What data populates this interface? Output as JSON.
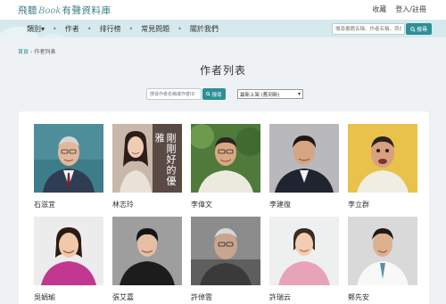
{
  "header": {
    "logo_cn1": "飛聽",
    "logo_en": "Book",
    "logo_cn2": "有聲資料庫",
    "links": [
      "收藏",
      "登入/註冊"
    ]
  },
  "nav": {
    "items": [
      "類別",
      "作者",
      "排行榜",
      "常見問題",
      "關於我們"
    ],
    "category_arrow": "▾",
    "search_placeholder": "搜尋書籍名稱、作者名稱、旁白",
    "search_button": "搜尋"
  },
  "breadcrumb": {
    "home": "首頁",
    "separator": "›",
    "current": "作者列表"
  },
  "page": {
    "title": "作者列表",
    "author_search_placeholder": "搜尋作者名稱或作者ID",
    "author_search_button": "搜尋",
    "sort_selected": "最新上架 (舊到新)"
  },
  "authors": [
    {
      "name": "石滋宜"
    },
    {
      "name": "林志玲",
      "poster_text": "剛剛好的優雅"
    },
    {
      "name": "李偉文"
    },
    {
      "name": "李建復"
    },
    {
      "name": "李立群"
    },
    {
      "name": "吳娟瑜"
    },
    {
      "name": "張艾嘉"
    },
    {
      "name": "許倬雲"
    },
    {
      "name": "許瑞云"
    },
    {
      "name": "鄭先安"
    }
  ],
  "colors": {
    "accent": "#2e8f95",
    "nav_bg": "#d6eaee",
    "page_bg": "#eef2f4"
  }
}
